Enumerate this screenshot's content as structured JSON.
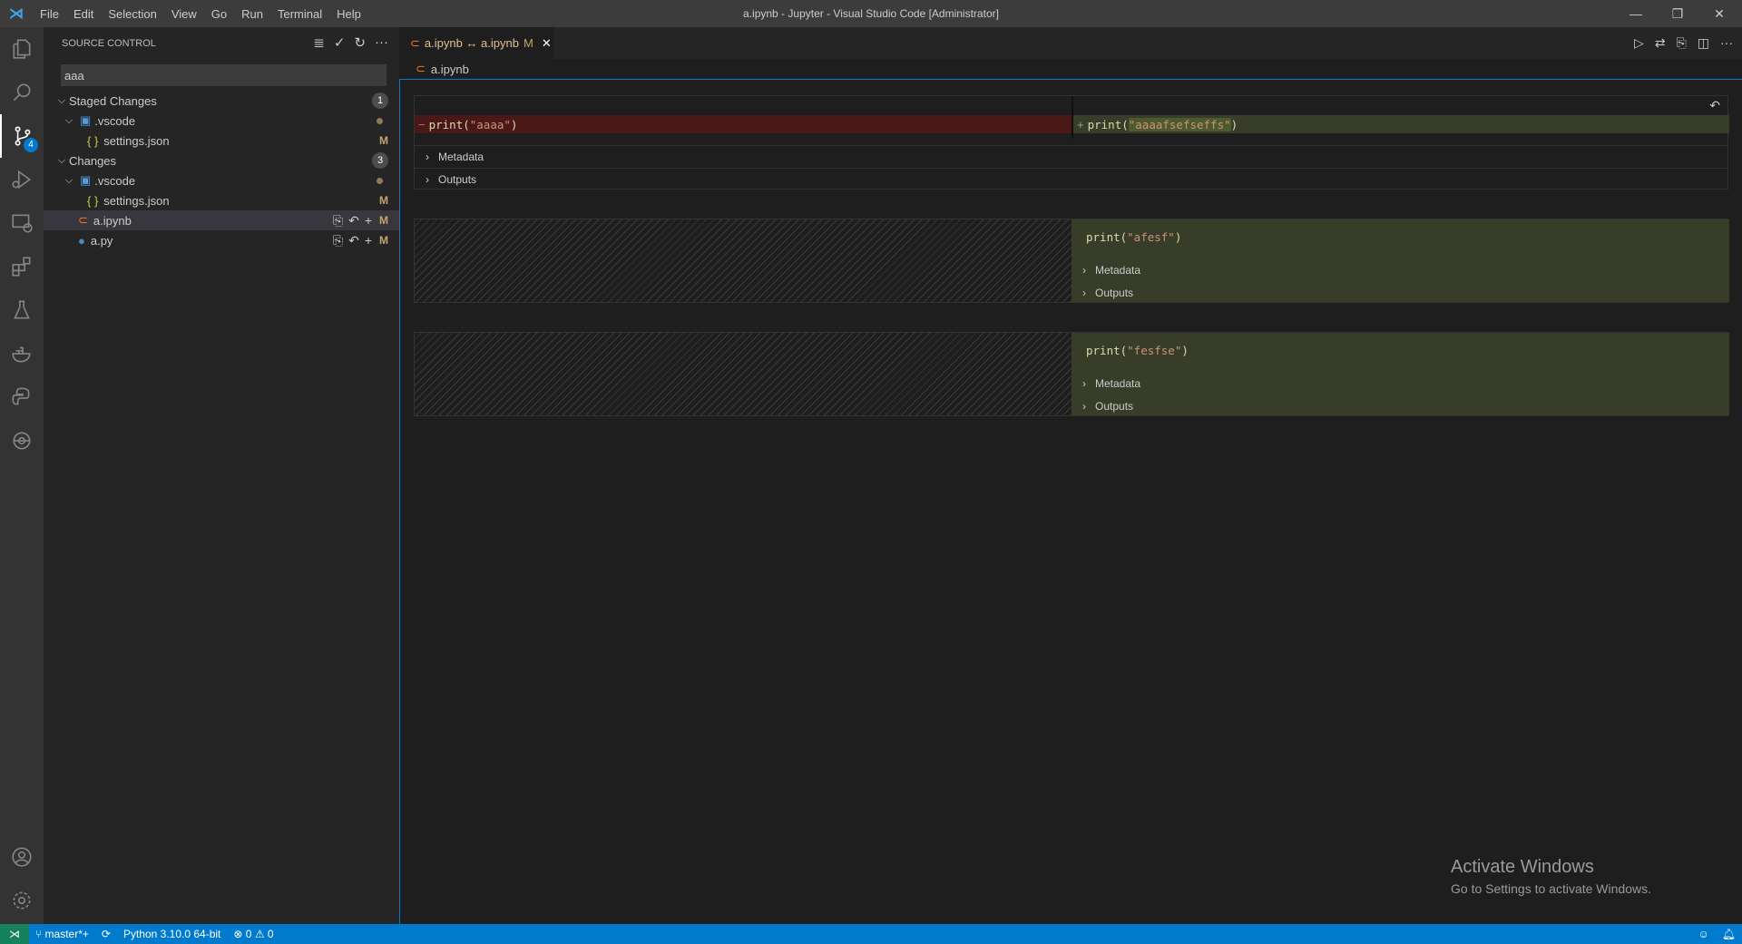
{
  "titlebar": {
    "menus": [
      "File",
      "Edit",
      "Selection",
      "View",
      "Go",
      "Run",
      "Terminal",
      "Help"
    ],
    "title": "a.ipynb - Jupyter - Visual Studio Code [Administrator]"
  },
  "activity": {
    "items": [
      "explorer-icon",
      "search-icon",
      "source-control-icon",
      "run-debug-icon",
      "remote-explorer-icon",
      "extensions-icon",
      "testing-icon",
      "docker-icon",
      "python-icon",
      "gitlens-icon"
    ],
    "scm_badge": "4",
    "bottom": [
      "account-icon",
      "settings-gear-icon"
    ]
  },
  "sidebar": {
    "title": "SOURCE CONTROL",
    "commit_message": "aaa",
    "staged": {
      "label": "Staged Changes",
      "count": "1",
      "folder": ".vscode",
      "file": "settings.json",
      "status": "M"
    },
    "changes": {
      "label": "Changes",
      "count": "3",
      "folder": ".vscode",
      "file": "settings.json",
      "file_status": "M",
      "items": [
        {
          "name": "a.ipynb",
          "status": "M"
        },
        {
          "name": "a.py",
          "status": "M"
        }
      ]
    }
  },
  "tab": {
    "label": "a.ipynb ↔ a.ipynb",
    "status": "M"
  },
  "breadcrumb": "a.ipynb",
  "diff": {
    "cell1": {
      "removed_fn": "print(",
      "removed_str": "\"aaaa\"",
      "added_fn": "print(",
      "added_str": "\"aaaafsefseffs\"",
      "close": ")"
    },
    "cell2": {
      "fn": "print(",
      "str": "\"afesf\"",
      "close": ")"
    },
    "cell3": {
      "fn": "print(",
      "str": "\"fesfse\"",
      "close": ")"
    },
    "metadata_label": "Metadata",
    "outputs_label": "Outputs"
  },
  "status": {
    "branch": "master*+",
    "python": "Python 3.10.0 64-bit",
    "errors": "0",
    "warnings": "0"
  },
  "watermark": {
    "title": "Activate Windows",
    "subtitle": "Go to Settings to activate Windows."
  },
  "colors": {
    "accent": "#007acc",
    "removed": "#4b1818",
    "added": "#373d29",
    "modified": "#e2c08d"
  }
}
